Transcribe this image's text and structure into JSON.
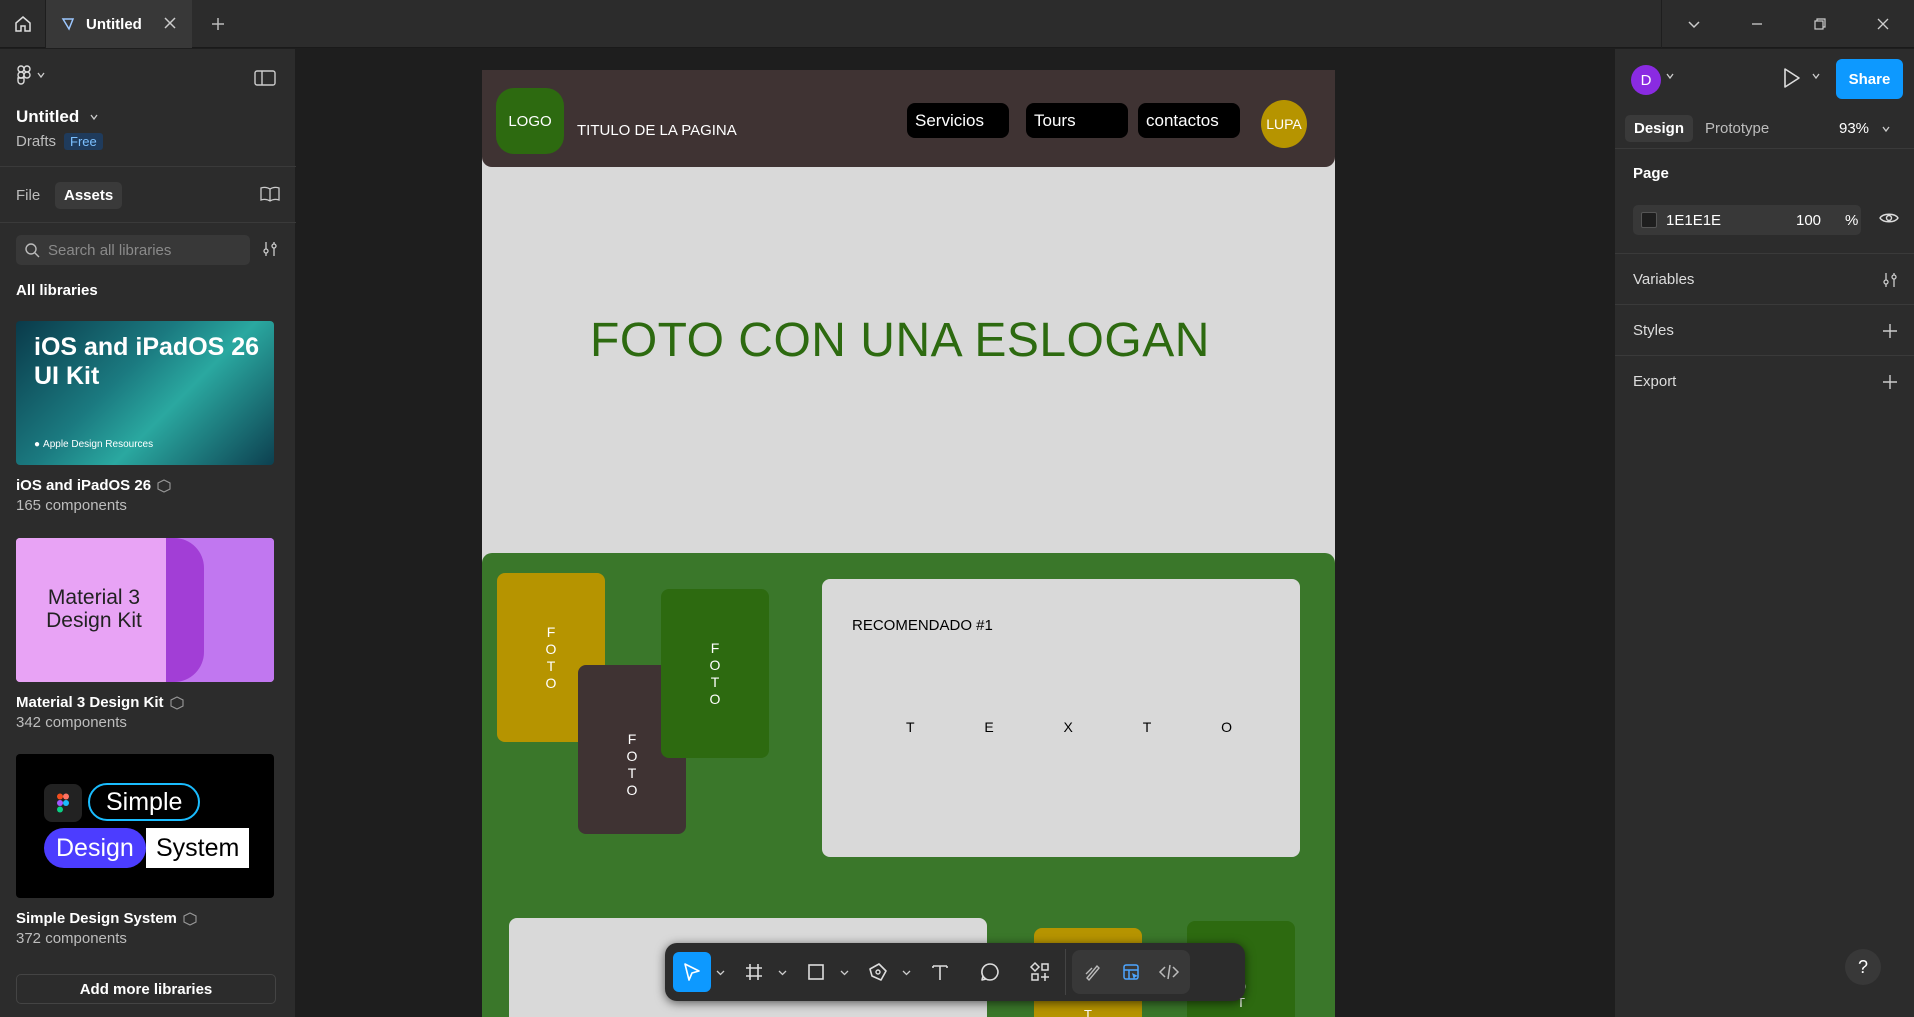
{
  "titlebar": {
    "tab_title": "Untitled"
  },
  "left_panel": {
    "file_name": "Untitled",
    "location": "Drafts",
    "plan_badge": "Free",
    "tabs": [
      {
        "label": "File"
      },
      {
        "label": "Assets"
      }
    ],
    "search_placeholder": "Search all libraries",
    "all_libraries_label": "All libraries",
    "libraries": [
      {
        "name": "iOS and iPadOS 26",
        "count": "165 components",
        "thumb_text_line1": "iOS and iPadOS 26",
        "thumb_text_line2": "UI Kit",
        "thumb_footer": "Apple Design Resources"
      },
      {
        "name": "Material 3 Design Kit",
        "count": "342 components",
        "thumb_text_line1": "Material 3",
        "thumb_text_line2": "Design Kit"
      },
      {
        "name": "Simple Design System",
        "count": "372 components",
        "thumb_words": [
          "Simple",
          "Design",
          "System"
        ]
      }
    ],
    "add_libraries_label": "Add more libraries"
  },
  "canvas": {
    "header": {
      "logo": "LOGO",
      "page_title": "TITULO DE LA PAGINA",
      "nav": [
        "Servicios",
        "Tours",
        "contactos"
      ],
      "search": "LUPA"
    },
    "slogan": "FOTO CON UNA ESLOGAN",
    "photo_label": "FOTO",
    "recommended": {
      "title": "RECOMENDADO #1",
      "letters": [
        "T",
        "E",
        "X",
        "T",
        "O"
      ]
    },
    "colors": {
      "header": "#3f3333",
      "logo": "#2d6a10",
      "gold": "#b69400",
      "green_section": "#3a772a",
      "dark_green": "#2d6a10",
      "frame_bg": "#d9d9d9"
    }
  },
  "toolbar": {
    "tools": [
      "move-icon",
      "frame-icon",
      "rectangle-icon",
      "pen-icon",
      "text-icon",
      "comment-icon",
      "actions-icon",
      "draw-icon",
      "design-mode-icon",
      "dev-mode-icon"
    ],
    "active": "move-icon"
  },
  "right_panel": {
    "avatar_initial": "D",
    "share_label": "Share",
    "tabs": [
      {
        "label": "Design"
      },
      {
        "label": "Prototype"
      }
    ],
    "zoom": "93%",
    "page_section": "Page",
    "page_color": "1E1E1E",
    "page_opacity": "100",
    "page_opacity_unit": "%",
    "variables_label": "Variables",
    "styles_label": "Styles",
    "export_label": "Export",
    "help": "?"
  }
}
